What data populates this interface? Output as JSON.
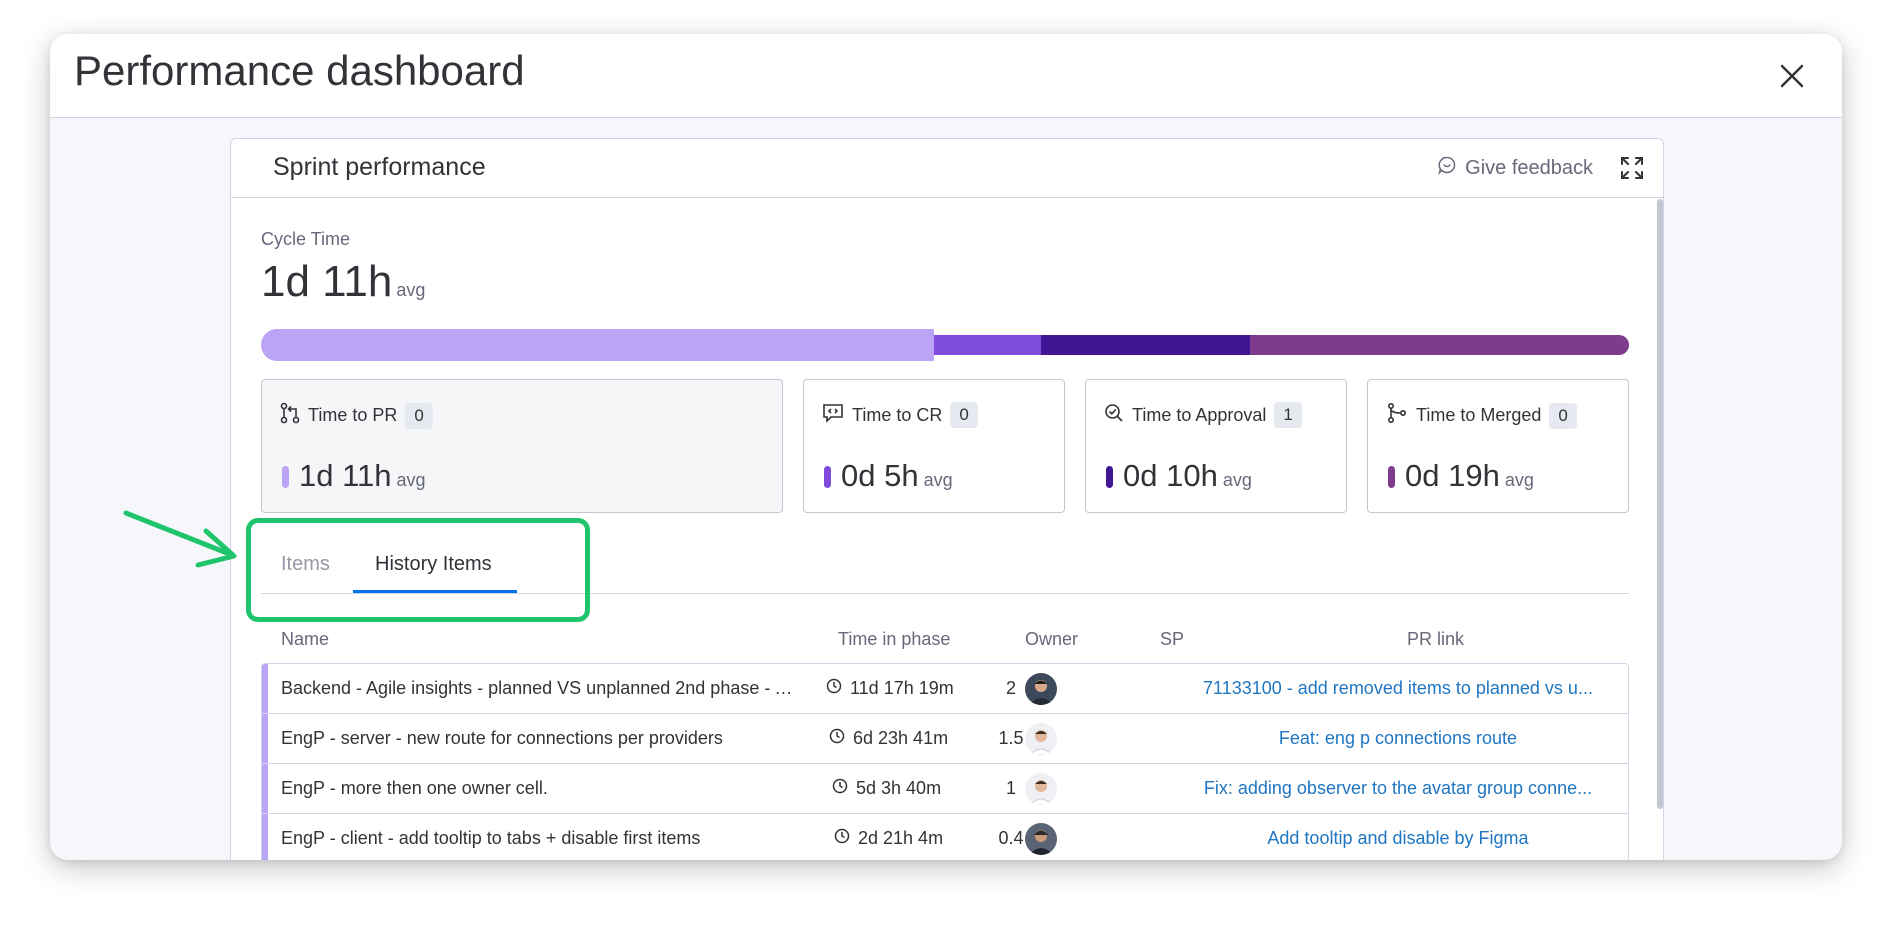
{
  "modal": {
    "title": "Performance dashboard",
    "close_icon": "close-icon"
  },
  "panel": {
    "title": "Sprint performance",
    "feedback_label": "Give feedback",
    "feedback_icon": "chat-bubble-icon",
    "expand_icon": "expand-icon"
  },
  "cycle": {
    "label": "Cycle Time",
    "value": "1d 11h",
    "avg": "avg"
  },
  "cycle_bar": {
    "segments": [
      {
        "name": "Time to PR",
        "color": "#bba4f5"
      },
      {
        "name": "Time to CR",
        "color": "#7e4bdc"
      },
      {
        "name": "Time to Approval",
        "color": "#401694"
      },
      {
        "name": "Time to Merged",
        "color": "#7f3b8c"
      }
    ]
  },
  "stats": [
    {
      "label": "Time to PR",
      "count": "0",
      "value": "1d 11h",
      "avg": "avg",
      "icon": "pull-request-icon",
      "color": "#bba4f5"
    },
    {
      "label": "Time to CR",
      "count": "0",
      "value": "0d 5h",
      "avg": "avg",
      "icon": "code-review-icon",
      "color": "#7e4bdc"
    },
    {
      "label": "Time to Approval",
      "count": "1",
      "value": "0d 10h",
      "avg": "avg",
      "icon": "approval-icon",
      "color": "#401694"
    },
    {
      "label": "Time to Merged",
      "count": "0",
      "value": "0d 19h",
      "avg": "avg",
      "icon": "merge-icon",
      "color": "#7f3b8c"
    }
  ],
  "tabs": [
    {
      "label": "Items",
      "active": false
    },
    {
      "label": "History Items",
      "active": true
    }
  ],
  "table": {
    "columns": {
      "name": "Name",
      "time": "Time in phase",
      "owner": "Owner",
      "sp": "SP",
      "pr": "PR link"
    },
    "rows": [
      {
        "name": "Backend - Agile insights - planned VS unplanned 2nd phase - A...",
        "time": "11d 17h 19m",
        "sp": "2",
        "pr": "71133100 - add removed items to planned vs u..."
      },
      {
        "name": "EngP - server - new route for connections per providers",
        "time": "6d 23h 41m",
        "sp": "1.5",
        "pr": "Feat: eng p connections route"
      },
      {
        "name": "EngP - more then one owner cell.",
        "time": "5d 3h 40m",
        "sp": "1",
        "pr": "Fix: adding observer to the avatar group conne..."
      },
      {
        "name": "EngP - client - add tooltip to tabs + disable first items",
        "time": "2d 21h 4m",
        "sp": "0.4",
        "pr": "Add tooltip and disable by Figma"
      }
    ]
  },
  "annotation": {
    "box_color": "#1fc46c",
    "arrow_color": "#1fc46c"
  }
}
